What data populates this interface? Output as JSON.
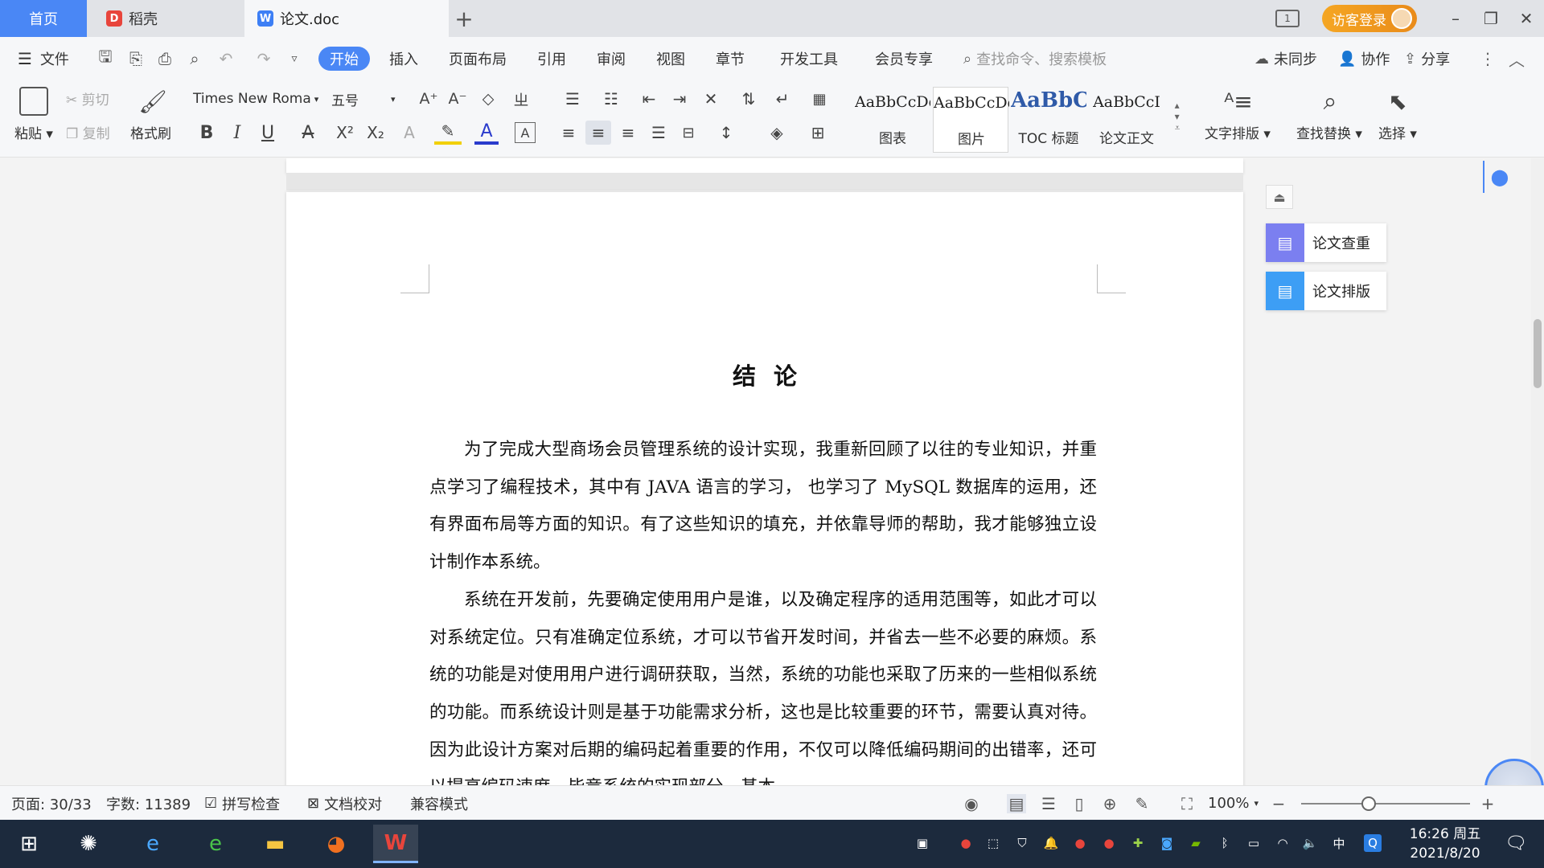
{
  "tabs": {
    "home": "首页",
    "daoke": "稻壳",
    "doc": "论文.doc",
    "add": "+"
  },
  "window": {
    "login": "访客登录",
    "layout_icon": "1"
  },
  "menu": {
    "file": "文件",
    "items": [
      "开始",
      "插入",
      "页面布局",
      "引用",
      "审阅",
      "视图",
      "章节",
      "开发工具",
      "会员专享"
    ],
    "search_placeholder": "查找命令、搜索模板",
    "unsync": "未同步",
    "collab": "协作",
    "share": "分享"
  },
  "ribbon": {
    "paste": "粘贴",
    "cut": "剪切",
    "copy": "复制",
    "format_painter": "格式刷",
    "font_name": "Times New Roma",
    "font_size": "五号",
    "styles": [
      {
        "sample": "AaBbCcDd",
        "name": "图表"
      },
      {
        "sample": "AaBbCcDd",
        "name": "图片"
      },
      {
        "sample": "AaBbC(",
        "name": "TOC 标题"
      },
      {
        "sample": "AaBbCcI",
        "name": "论文正文"
      }
    ],
    "text_layout": "文字排版",
    "find_replace": "查找替换",
    "select": "选择"
  },
  "document": {
    "title": "结论",
    "paragraphs": [
      "为了完成大型商场会员管理系统的设计实现，我重新回顾了以往的专业知识，并重点学习了编程技术，其中有 JAVA 语言的学习， 也学习了 MySQL 数据库的运用，还有界面布局等方面的知识。有了这些知识的填充，并依靠导师的帮助，我才能够独立设计制作本系统。",
      "系统在开发前，先要确定使用用户是谁，以及确定程序的适用范围等，如此才可以对系统定位。只有准确定位系统，才可以节省开发时间，并省去一些不必要的麻烦。系统的功能是对使用用户进行调研获取，当然，系统的功能也采取了历来的一些相似系统的功能。而系统设计则是基于功能需求分析，这也是比较重要的环节，需要认真对待。因为此设计方案对后期的编码起着重要的作用，不仅可以降低编码期间的出错率，还可以提高编码速度，毕竟系统的实现部分，基本"
    ]
  },
  "side_panel": {
    "check": "论文查重",
    "layout": "论文排版"
  },
  "status": {
    "page": "页面: 30/33",
    "words": "字数: 11389",
    "spell": "拼写检查",
    "proof": "文档校对",
    "compat": "兼容模式",
    "zoom": "100%",
    "zoom_level": 0.4
  },
  "taskbar": {
    "time": "16:26 周五",
    "date": "2021/8/20",
    "ime": "中"
  },
  "colors": {
    "accent": "#4a87f5",
    "login_orange": "#f5a623",
    "taskbar": "#1c2a3d"
  }
}
